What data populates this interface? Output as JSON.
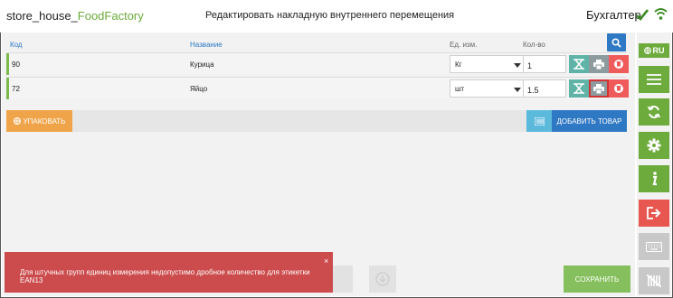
{
  "header": {
    "brand_main": "store_house_",
    "brand_accent": "FoodFactory",
    "title": "Редактировать накладную внутреннего перемещения",
    "user_role": "Бухгалтер"
  },
  "table": {
    "columns": {
      "code": "Код",
      "name": "Название",
      "unit": "Ед. изм.",
      "qty": "Кол-во"
    },
    "rows": [
      {
        "code": "90",
        "name": "Курица",
        "unit": "Кг",
        "qty": "1"
      },
      {
        "code": "72",
        "name": "Яйцо",
        "unit": "шт",
        "qty": "1.5"
      }
    ]
  },
  "actions": {
    "pack_label": "УПАКОВАТЬ",
    "add_label": "ДОБАВИТЬ ТОВАР"
  },
  "footer": {
    "save_label": "СОХРАНИТЬ"
  },
  "sidebar": {
    "lang_label": "RU"
  },
  "toast": {
    "message": "Для штучных групп единиц измерения недопустимо дробное количество для этикетки EAN13",
    "close": "×"
  },
  "colors": {
    "accent_green": "#6dab3c",
    "primary_blue": "#2f78c4",
    "danger_red": "#e8574f",
    "toast_red": "#cc4b4c",
    "pack_orange": "#f0a44a"
  }
}
